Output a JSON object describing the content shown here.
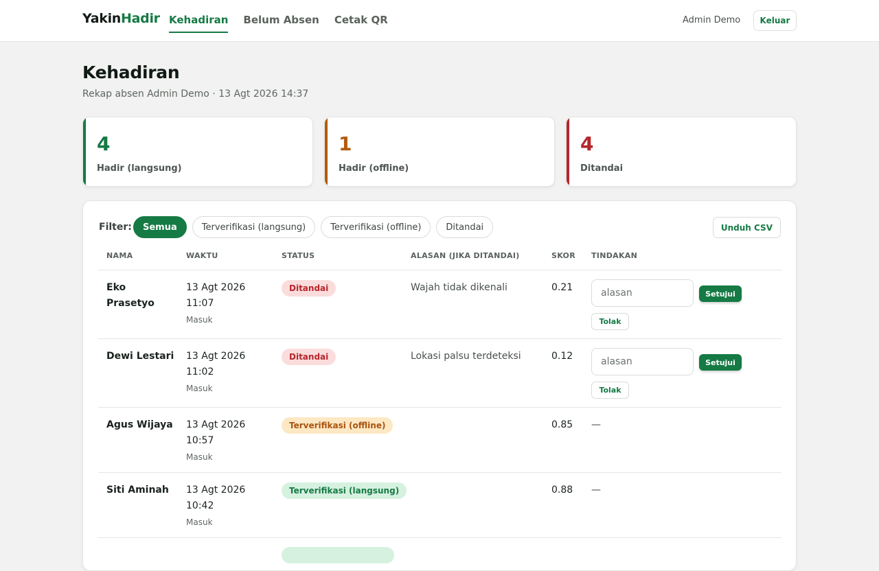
{
  "header": {
    "brand_part1": "Yakin",
    "brand_part2": "Hadir",
    "nav": [
      {
        "label": "Kehadiran",
        "active": true
      },
      {
        "label": "Belum Absen",
        "active": false
      },
      {
        "label": "Cetak QR",
        "active": false
      }
    ],
    "user": "Admin Demo",
    "logout_label": "Keluar"
  },
  "page": {
    "title": "Kehadiran",
    "subtitle": "Rekap absen Admin Demo · 13 Agt 2026 14:37"
  },
  "stats": [
    {
      "value": "4",
      "label": "Hadir (langsung)",
      "color": "#157a44"
    },
    {
      "value": "1",
      "label": "Hadir (offline)",
      "color": "#b35a10"
    },
    {
      "value": "4",
      "label": "Ditandai",
      "color": "#b5252b"
    }
  ],
  "filter": {
    "label": "Filter:",
    "chips": [
      {
        "label": "Semua",
        "active": true
      },
      {
        "label": "Terverifikasi (langsung)",
        "active": false
      },
      {
        "label": "Terverifikasi (offline)",
        "active": false
      },
      {
        "label": "Ditandai",
        "active": false
      }
    ],
    "csv_label": "Unduh CSV"
  },
  "table": {
    "headers": [
      "NAMA",
      "WAKTU",
      "STATUS",
      "ALASAN (JIKA DITANDAI)",
      "SKOR",
      "TINDAKAN"
    ],
    "rows": [
      {
        "name": "Eko Prasetyo",
        "date": "13 Agt 2026",
        "time": "11:07",
        "type": "Masuk",
        "status": "Ditandai",
        "reason": "Wajah tidak dikenali",
        "score": "0.21"
      },
      {
        "name": "Dewi Lestari",
        "date": "13 Agt 2026",
        "time": "11:02",
        "type": "Masuk",
        "status": "Ditandai",
        "reason": "Lokasi palsu terdeteksi",
        "score": "0.12"
      },
      {
        "name": "Agus Wijaya",
        "date": "13 Agt 2026",
        "time": "10:57",
        "type": "Masuk",
        "status": "Terverifikasi (offline)",
        "reason": "",
        "score": "0.85"
      },
      {
        "name": "Siti Aminah",
        "date": "13 Agt 2026",
        "time": "10:42",
        "type": "Masuk",
        "status": "Terverifikasi (langsung)",
        "reason": "",
        "score": "0.88"
      }
    ],
    "reason_placeholder": "alasan",
    "approve_label": "Setujui",
    "reject_label": "Tolak",
    "no_action": "—"
  }
}
